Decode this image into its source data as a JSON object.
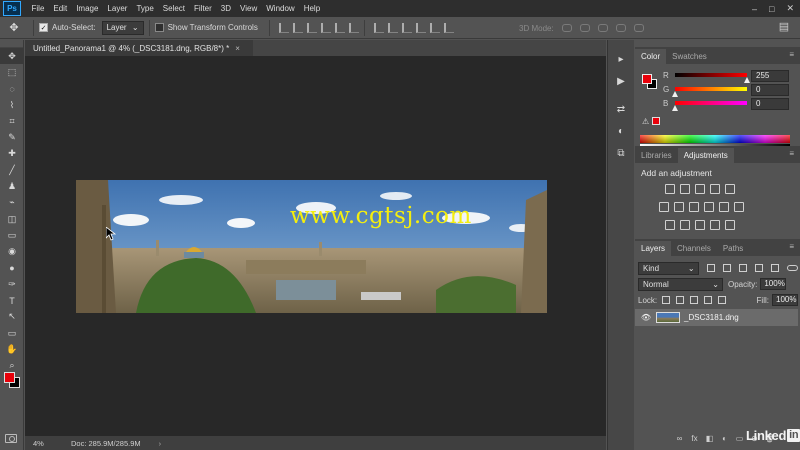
{
  "app": {
    "logo": "Ps"
  },
  "menu": [
    "File",
    "Edit",
    "Image",
    "Layer",
    "Type",
    "Select",
    "Filter",
    "3D",
    "View",
    "Window",
    "Help"
  ],
  "window_controls": {
    "minimize": "–",
    "maximize": "□",
    "close": "✕"
  },
  "options_bar": {
    "tool_glyph": "✥",
    "auto_select_label": "Auto-Select:",
    "auto_select_checked": "✓",
    "auto_select_target": "Layer",
    "show_transform_label": "Show Transform Controls",
    "mode_3d_label": "3D Mode:",
    "workspace_glyph": "▤"
  },
  "tools": [
    "✥",
    "⬚",
    "◌",
    "⌇",
    "⌗",
    "✎",
    "✚",
    "╱",
    "♟",
    "⌁",
    "◫",
    "▭",
    "◉",
    "●",
    "✑",
    "T",
    "↖",
    "▭",
    "✋",
    "⌕",
    "⋯"
  ],
  "swatch_colors": {
    "foreground": "#e8000a",
    "background": "#000000"
  },
  "document": {
    "tab_title": "Untitled_Panorama1 @ 4% (_DSC3181.dng, RGB/8*) *",
    "tab_close": "×",
    "watermark": "www.cgtsj.com",
    "zoom": "4%",
    "doc_info": "Doc: 285.9M/285.9M",
    "status_arrow": "›"
  },
  "side_strip": [
    "▸",
    "▶",
    "⇄",
    "◐",
    "⧉"
  ],
  "color_panel": {
    "tabs": [
      "Color",
      "Swatches"
    ],
    "menu": "≡",
    "r_label": "R",
    "r_value": "255",
    "g_label": "G",
    "g_value": "0",
    "b_label": "B",
    "b_value": "0",
    "warning_glyph": "⚠"
  },
  "adjustments_panel": {
    "tabs": [
      "Libraries",
      "Adjustments"
    ],
    "menu": "≡",
    "title": "Add an adjustment"
  },
  "layers_panel": {
    "tabs": [
      "Layers",
      "Channels",
      "Paths"
    ],
    "menu": "≡",
    "filter_label": "Kind",
    "blend_mode": "Normal",
    "opacity_label": "Opacity:",
    "opacity_value": "100%",
    "lock_label": "Lock:",
    "fill_label": "Fill:",
    "fill_value": "100%",
    "layer_name": "_DSC3181.dng",
    "eye_glyph": "👁",
    "footer": [
      "∞",
      "fx",
      "◧",
      "◐",
      "▭",
      "⊕",
      "🗑"
    ]
  },
  "brand": {
    "linked": "Linked",
    "in": "in"
  }
}
